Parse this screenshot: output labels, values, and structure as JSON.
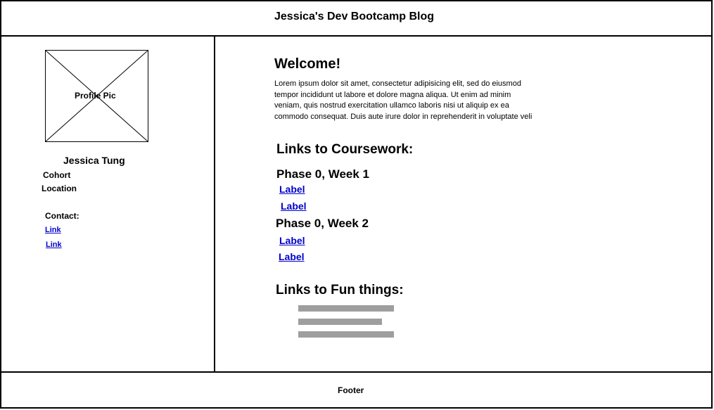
{
  "header": {
    "title": "Jessica's Dev Bootcamp Blog"
  },
  "sidebar": {
    "profile_pic_label": "Profile Pic",
    "name": "Jessica Tung",
    "cohort": "Cohort",
    "location": "Location",
    "contact_heading": "Contact:",
    "links": [
      "Link",
      "Link"
    ]
  },
  "main": {
    "welcome_heading": "Welcome!",
    "welcome_lines": [
      "Lorem ipsum dolor sit amet, consectetur adipisicing elit, sed do eiusmod",
      "tempor incididunt ut labore et dolore magna aliqua. Ut enim ad minim",
      "veniam, quis nostrud exercitation ullamco laboris nisi ut aliquip ex ea",
      "commodo consequat. Duis aute irure dolor in reprehenderit in voluptate veli"
    ],
    "coursework_heading": "Links to Coursework:",
    "weeks": [
      {
        "title": "Phase 0, Week 1",
        "links": [
          "Label",
          "Label"
        ]
      },
      {
        "title": "Phase 0, Week 2",
        "links": [
          "Label",
          "Label"
        ]
      }
    ],
    "fun_heading": "Links to Fun things:"
  },
  "footer": {
    "label": "Footer"
  }
}
